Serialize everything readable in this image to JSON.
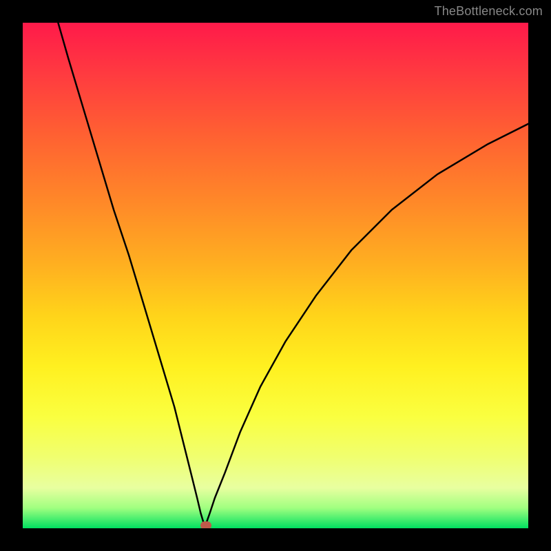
{
  "watermark": "TheBottleneck.com",
  "chart_data": {
    "type": "line",
    "title": "",
    "xlabel": "",
    "ylabel": "",
    "xlim": [
      0,
      100
    ],
    "ylim": [
      0,
      100
    ],
    "series": [
      {
        "name": "bottleneck-curve",
        "x": [
          7,
          9,
          12,
          15,
          18,
          21,
          24,
          27,
          30,
          32,
          33.5,
          34.5,
          35.2,
          35.8,
          36,
          36.3,
          37,
          38,
          40,
          43,
          47,
          52,
          58,
          65,
          73,
          82,
          92,
          100
        ],
        "y": [
          100,
          93,
          83,
          73,
          63,
          54,
          44,
          34,
          24,
          16,
          10,
          6,
          3,
          1,
          0.2,
          1,
          3,
          6,
          11,
          19,
          28,
          37,
          46,
          55,
          63,
          70,
          76,
          80
        ]
      }
    ],
    "marker": {
      "x_pct": 36.2,
      "y_pct": 0.6,
      "color": "#c05a4a"
    },
    "gradient_stops": [
      {
        "pct": 0,
        "color": "#ff1a4a"
      },
      {
        "pct": 36,
        "color": "#ff8a28"
      },
      {
        "pct": 68,
        "color": "#fff020"
      },
      {
        "pct": 92,
        "color": "#e8ffa0"
      },
      {
        "pct": 100,
        "color": "#00e060"
      }
    ]
  }
}
